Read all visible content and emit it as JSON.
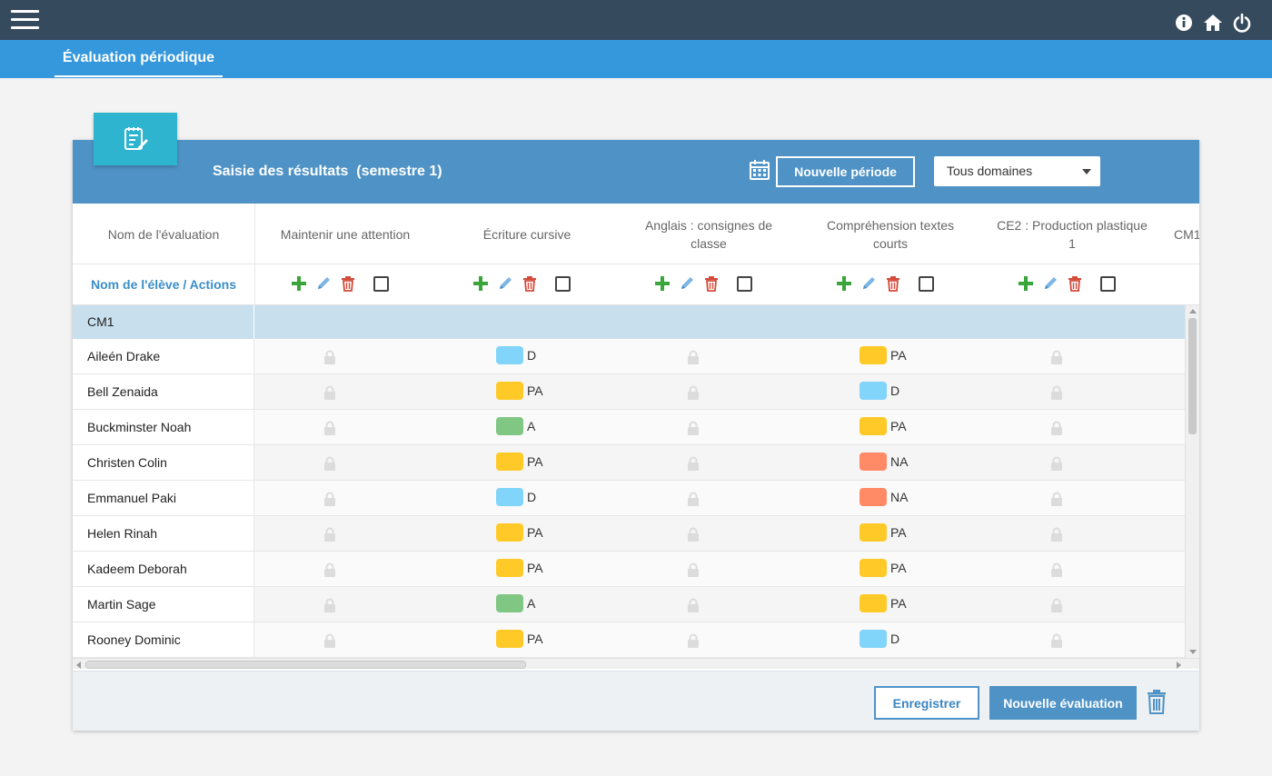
{
  "topbar": {
    "icons": [
      "menu-icon",
      "info-icon",
      "home-icon",
      "power-icon"
    ]
  },
  "subtab": {
    "label": "Évaluation périodique"
  },
  "card": {
    "title": "Saisie des résultats  (semestre 1)",
    "new_period_label": "Nouvelle période",
    "domain_select": {
      "selected": "Tous domaines"
    }
  },
  "grid": {
    "first_col_header": "Nom de l'évaluation",
    "actions_label": "Nom de l'élève / Actions",
    "columns": [
      "Maintenir une attention",
      "Écriture cursive",
      "Anglais : consignes de classe",
      "Compréhension textes courts",
      "CE2 : Production plastique 1",
      "CM1"
    ],
    "group": "CM1",
    "students": [
      {
        "name": "Aileén Drake",
        "ecriture": "D",
        "comprehension": "PA"
      },
      {
        "name": "Bell Zenaida",
        "ecriture": "PA",
        "comprehension": "D"
      },
      {
        "name": "Buckminster Noah",
        "ecriture": "A",
        "comprehension": "PA"
      },
      {
        "name": "Christen Colin",
        "ecriture": "PA",
        "comprehension": "NA"
      },
      {
        "name": "Emmanuel Paki",
        "ecriture": "D",
        "comprehension": "NA"
      },
      {
        "name": "Helen Rinah",
        "ecriture": "PA",
        "comprehension": "PA"
      },
      {
        "name": "Kadeem Deborah",
        "ecriture": "PA",
        "comprehension": "PA"
      },
      {
        "name": "Martin Sage",
        "ecriture": "A",
        "comprehension": "PA"
      },
      {
        "name": "Rooney Dominic",
        "ecriture": "PA",
        "comprehension": "D"
      }
    ],
    "level_colors": {
      "D": "#81d4fa",
      "PA": "#ffca28",
      "A": "#81c784",
      "NA": "#ff8a65"
    }
  },
  "footer": {
    "save_label": "Enregistrer",
    "new_eval_label": "Nouvelle évaluation"
  }
}
